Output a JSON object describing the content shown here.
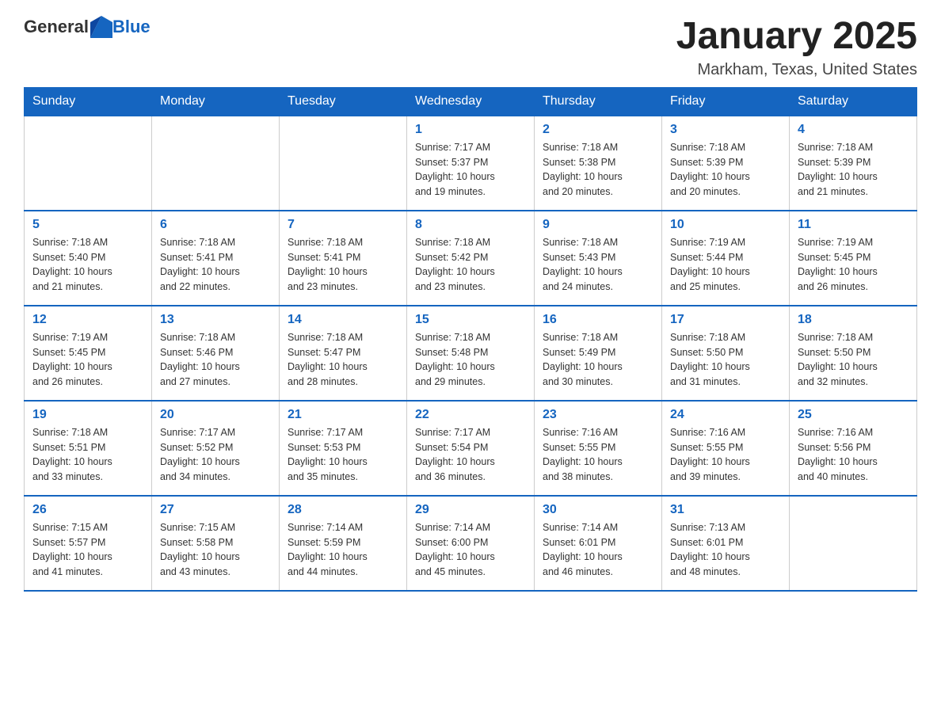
{
  "header": {
    "logo_general": "General",
    "logo_blue": "Blue",
    "month_year": "January 2025",
    "location": "Markham, Texas, United States"
  },
  "days_of_week": [
    "Sunday",
    "Monday",
    "Tuesday",
    "Wednesday",
    "Thursday",
    "Friday",
    "Saturday"
  ],
  "weeks": [
    [
      {
        "day": "",
        "info": ""
      },
      {
        "day": "",
        "info": ""
      },
      {
        "day": "",
        "info": ""
      },
      {
        "day": "1",
        "info": "Sunrise: 7:17 AM\nSunset: 5:37 PM\nDaylight: 10 hours\nand 19 minutes."
      },
      {
        "day": "2",
        "info": "Sunrise: 7:18 AM\nSunset: 5:38 PM\nDaylight: 10 hours\nand 20 minutes."
      },
      {
        "day": "3",
        "info": "Sunrise: 7:18 AM\nSunset: 5:39 PM\nDaylight: 10 hours\nand 20 minutes."
      },
      {
        "day": "4",
        "info": "Sunrise: 7:18 AM\nSunset: 5:39 PM\nDaylight: 10 hours\nand 21 minutes."
      }
    ],
    [
      {
        "day": "5",
        "info": "Sunrise: 7:18 AM\nSunset: 5:40 PM\nDaylight: 10 hours\nand 21 minutes."
      },
      {
        "day": "6",
        "info": "Sunrise: 7:18 AM\nSunset: 5:41 PM\nDaylight: 10 hours\nand 22 minutes."
      },
      {
        "day": "7",
        "info": "Sunrise: 7:18 AM\nSunset: 5:41 PM\nDaylight: 10 hours\nand 23 minutes."
      },
      {
        "day": "8",
        "info": "Sunrise: 7:18 AM\nSunset: 5:42 PM\nDaylight: 10 hours\nand 23 minutes."
      },
      {
        "day": "9",
        "info": "Sunrise: 7:18 AM\nSunset: 5:43 PM\nDaylight: 10 hours\nand 24 minutes."
      },
      {
        "day": "10",
        "info": "Sunrise: 7:19 AM\nSunset: 5:44 PM\nDaylight: 10 hours\nand 25 minutes."
      },
      {
        "day": "11",
        "info": "Sunrise: 7:19 AM\nSunset: 5:45 PM\nDaylight: 10 hours\nand 26 minutes."
      }
    ],
    [
      {
        "day": "12",
        "info": "Sunrise: 7:19 AM\nSunset: 5:45 PM\nDaylight: 10 hours\nand 26 minutes."
      },
      {
        "day": "13",
        "info": "Sunrise: 7:18 AM\nSunset: 5:46 PM\nDaylight: 10 hours\nand 27 minutes."
      },
      {
        "day": "14",
        "info": "Sunrise: 7:18 AM\nSunset: 5:47 PM\nDaylight: 10 hours\nand 28 minutes."
      },
      {
        "day": "15",
        "info": "Sunrise: 7:18 AM\nSunset: 5:48 PM\nDaylight: 10 hours\nand 29 minutes."
      },
      {
        "day": "16",
        "info": "Sunrise: 7:18 AM\nSunset: 5:49 PM\nDaylight: 10 hours\nand 30 minutes."
      },
      {
        "day": "17",
        "info": "Sunrise: 7:18 AM\nSunset: 5:50 PM\nDaylight: 10 hours\nand 31 minutes."
      },
      {
        "day": "18",
        "info": "Sunrise: 7:18 AM\nSunset: 5:50 PM\nDaylight: 10 hours\nand 32 minutes."
      }
    ],
    [
      {
        "day": "19",
        "info": "Sunrise: 7:18 AM\nSunset: 5:51 PM\nDaylight: 10 hours\nand 33 minutes."
      },
      {
        "day": "20",
        "info": "Sunrise: 7:17 AM\nSunset: 5:52 PM\nDaylight: 10 hours\nand 34 minutes."
      },
      {
        "day": "21",
        "info": "Sunrise: 7:17 AM\nSunset: 5:53 PM\nDaylight: 10 hours\nand 35 minutes."
      },
      {
        "day": "22",
        "info": "Sunrise: 7:17 AM\nSunset: 5:54 PM\nDaylight: 10 hours\nand 36 minutes."
      },
      {
        "day": "23",
        "info": "Sunrise: 7:16 AM\nSunset: 5:55 PM\nDaylight: 10 hours\nand 38 minutes."
      },
      {
        "day": "24",
        "info": "Sunrise: 7:16 AM\nSunset: 5:55 PM\nDaylight: 10 hours\nand 39 minutes."
      },
      {
        "day": "25",
        "info": "Sunrise: 7:16 AM\nSunset: 5:56 PM\nDaylight: 10 hours\nand 40 minutes."
      }
    ],
    [
      {
        "day": "26",
        "info": "Sunrise: 7:15 AM\nSunset: 5:57 PM\nDaylight: 10 hours\nand 41 minutes."
      },
      {
        "day": "27",
        "info": "Sunrise: 7:15 AM\nSunset: 5:58 PM\nDaylight: 10 hours\nand 43 minutes."
      },
      {
        "day": "28",
        "info": "Sunrise: 7:14 AM\nSunset: 5:59 PM\nDaylight: 10 hours\nand 44 minutes."
      },
      {
        "day": "29",
        "info": "Sunrise: 7:14 AM\nSunset: 6:00 PM\nDaylight: 10 hours\nand 45 minutes."
      },
      {
        "day": "30",
        "info": "Sunrise: 7:14 AM\nSunset: 6:01 PM\nDaylight: 10 hours\nand 46 minutes."
      },
      {
        "day": "31",
        "info": "Sunrise: 7:13 AM\nSunset: 6:01 PM\nDaylight: 10 hours\nand 48 minutes."
      },
      {
        "day": "",
        "info": ""
      }
    ]
  ]
}
